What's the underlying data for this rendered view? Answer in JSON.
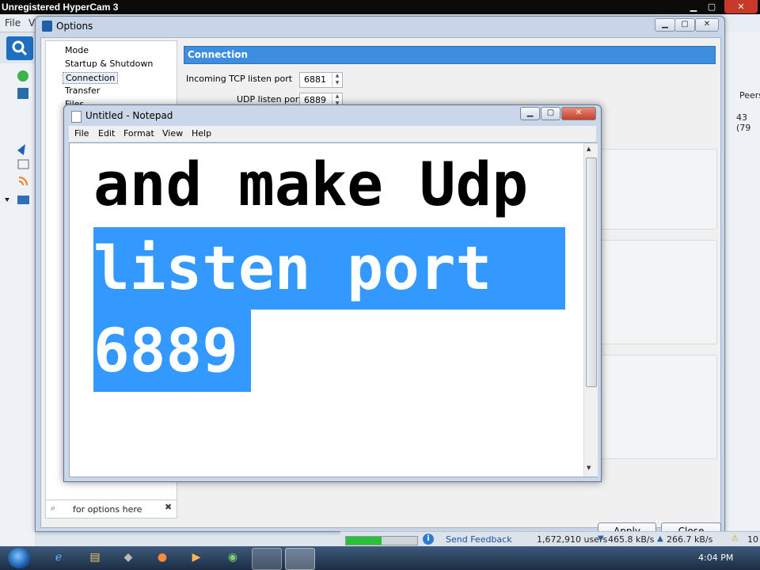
{
  "hypercam": {
    "title": "Unregistered HyperCam 3"
  },
  "background_app": {
    "menu": [
      "File",
      "V"
    ],
    "peers_header": "Peers",
    "peers_value": "43 (79"
  },
  "options": {
    "title": "Options",
    "tree": [
      "Mode",
      "Startup & Shutdown",
      "Connection",
      "Transfer",
      "Files"
    ],
    "filter_placeholder": "for options here",
    "section_title": "Connection",
    "tcp_label": "Incoming TCP listen port",
    "tcp_value": "6881",
    "udp_label": "UDP listen port",
    "udp_value": "6889",
    "apply_label": "Apply",
    "close_label": "Close"
  },
  "notepad": {
    "title": "Untitled - Notepad",
    "menu": [
      "File",
      "Edit",
      "Format",
      "View",
      "Help"
    ],
    "lines": [
      "and make Udp",
      "listen port ",
      "6889"
    ]
  },
  "status": {
    "send_feedback": "Send Feedback",
    "users": "1,672,910 users",
    "down_speed": "465.8 kB/s",
    "up_speed": "266.7 kB/s",
    "extra": "10"
  },
  "taskbar": {
    "clock": "4:04 PM"
  },
  "colors": {
    "selection": "#3399ff",
    "section_header": "#3d8ee0",
    "hc_close": "#c8392a"
  },
  "window_buttons": {
    "minimize": "▁",
    "maximize": "▢",
    "close": "✕"
  }
}
